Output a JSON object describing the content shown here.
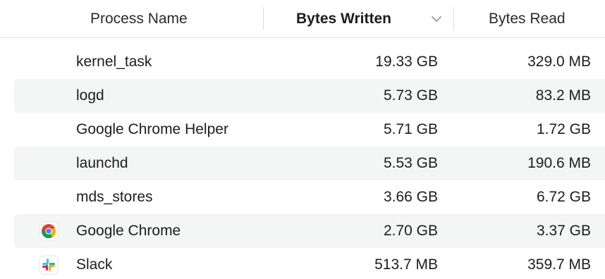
{
  "columns": {
    "name": "Process Name",
    "written": "Bytes Written",
    "read": "Bytes Read"
  },
  "sort": {
    "column": "Bytes Written",
    "direction": "descending",
    "icon": "chevron-down-icon"
  },
  "rows": [
    {
      "name": "kernel_task",
      "written": "19.33 GB",
      "read": "329.0 MB",
      "icon": null
    },
    {
      "name": "logd",
      "written": "5.73 GB",
      "read": "83.2 MB",
      "icon": null
    },
    {
      "name": "Google Chrome Helper",
      "written": "5.71 GB",
      "read": "1.72 GB",
      "icon": null
    },
    {
      "name": "launchd",
      "written": "5.53 GB",
      "read": "190.6 MB",
      "icon": null
    },
    {
      "name": "mds_stores",
      "written": "3.66 GB",
      "read": "6.72 GB",
      "icon": null
    },
    {
      "name": "Google Chrome",
      "written": "2.70 GB",
      "read": "3.37 GB",
      "icon": "chrome-app-icon"
    },
    {
      "name": "Slack",
      "written": "513.7 MB",
      "read": "359.7 MB",
      "icon": "slack-app-icon"
    }
  ],
  "colors": {
    "row_alt_background": "#f4f5f5",
    "header_border": "#e3e3e3",
    "text": "#1d1d1f"
  }
}
